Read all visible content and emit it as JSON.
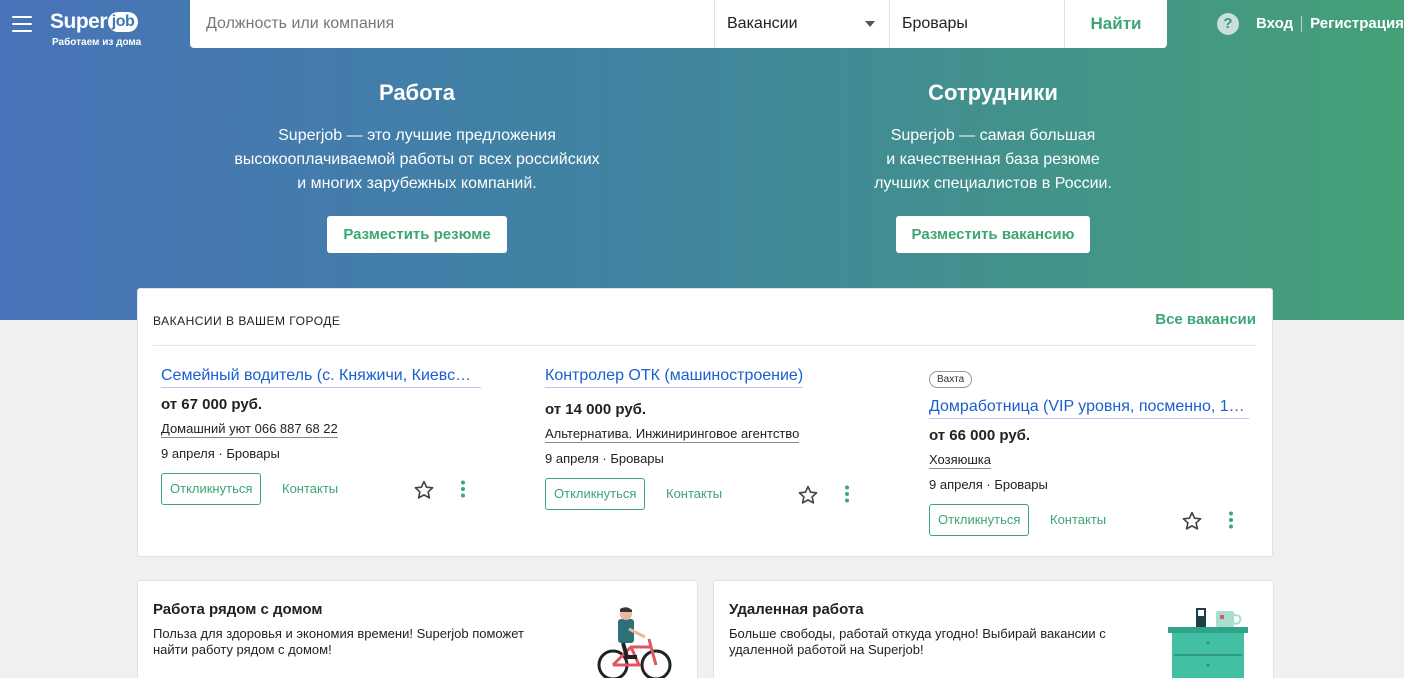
{
  "header": {
    "logo_name_prefix": "Super",
    "logo_name_suffix": "job",
    "logo_tagline": "Работаем из дома",
    "search_placeholder": "Должность или компания",
    "search_type": "Вакансии",
    "search_city": "Бровары",
    "search_button": "Найти",
    "help_icon": "help-circle-icon",
    "login": "Вход",
    "register": "Регистрация"
  },
  "promo": {
    "left": {
      "title": "Работа",
      "lines": [
        "Superjob — это лучшие предложения",
        "высокооплачиваемой работы от всех российских",
        "и многих зарубежных компаний."
      ],
      "button": "Разместить резюме"
    },
    "right": {
      "title": "Сотрудники",
      "lines": [
        "Superjob — самая большая",
        "и качественная база резюме",
        "лучших специалистов в России."
      ],
      "button": "Разместить вакансию"
    }
  },
  "vacancies": {
    "heading": "ВАКАНСИИ В ВАШЕМ ГОРОДЕ",
    "all_link": "Все вакансии",
    "respond_label": "Откликнуться",
    "contacts_label": "Контакты",
    "items": [
      {
        "badge": "",
        "title": "Семейный водитель (с. Княжичи, Киевс…",
        "salary": "от 67 000 руб.",
        "company": "Домашний уют 066 887 68 22",
        "meta": "9 апреля · Бровары"
      },
      {
        "badge": "",
        "title": "Контролер ОТК (машиностроение)",
        "salary": "от 14 000 руб.",
        "company": "Альтернатива. Инжиниринговое агентство",
        "meta": "9 апреля · Бровары"
      },
      {
        "badge": "Вахта",
        "title": "Домработница (VIP уровня, посменно, 1…",
        "salary": "от 66 000 руб.",
        "company": "Хозяюшка",
        "meta": "9 апреля · Бровары"
      }
    ]
  },
  "features": {
    "nearby": {
      "title": "Работа рядом с домом",
      "text": "Польза для здоровья и экономия времени! Superjob поможет найти работу рядом с домом!"
    },
    "remote": {
      "title": "Удаленная работа",
      "text": "Больше свободы, работай откуда угодно! Выбирай вакансии с удаленной работой на Superjob!"
    }
  },
  "colors": {
    "accent_green": "#3ea574",
    "link_blue": "#1a5fd0",
    "gradient_start": "#4873b8",
    "gradient_end": "#45a077"
  }
}
